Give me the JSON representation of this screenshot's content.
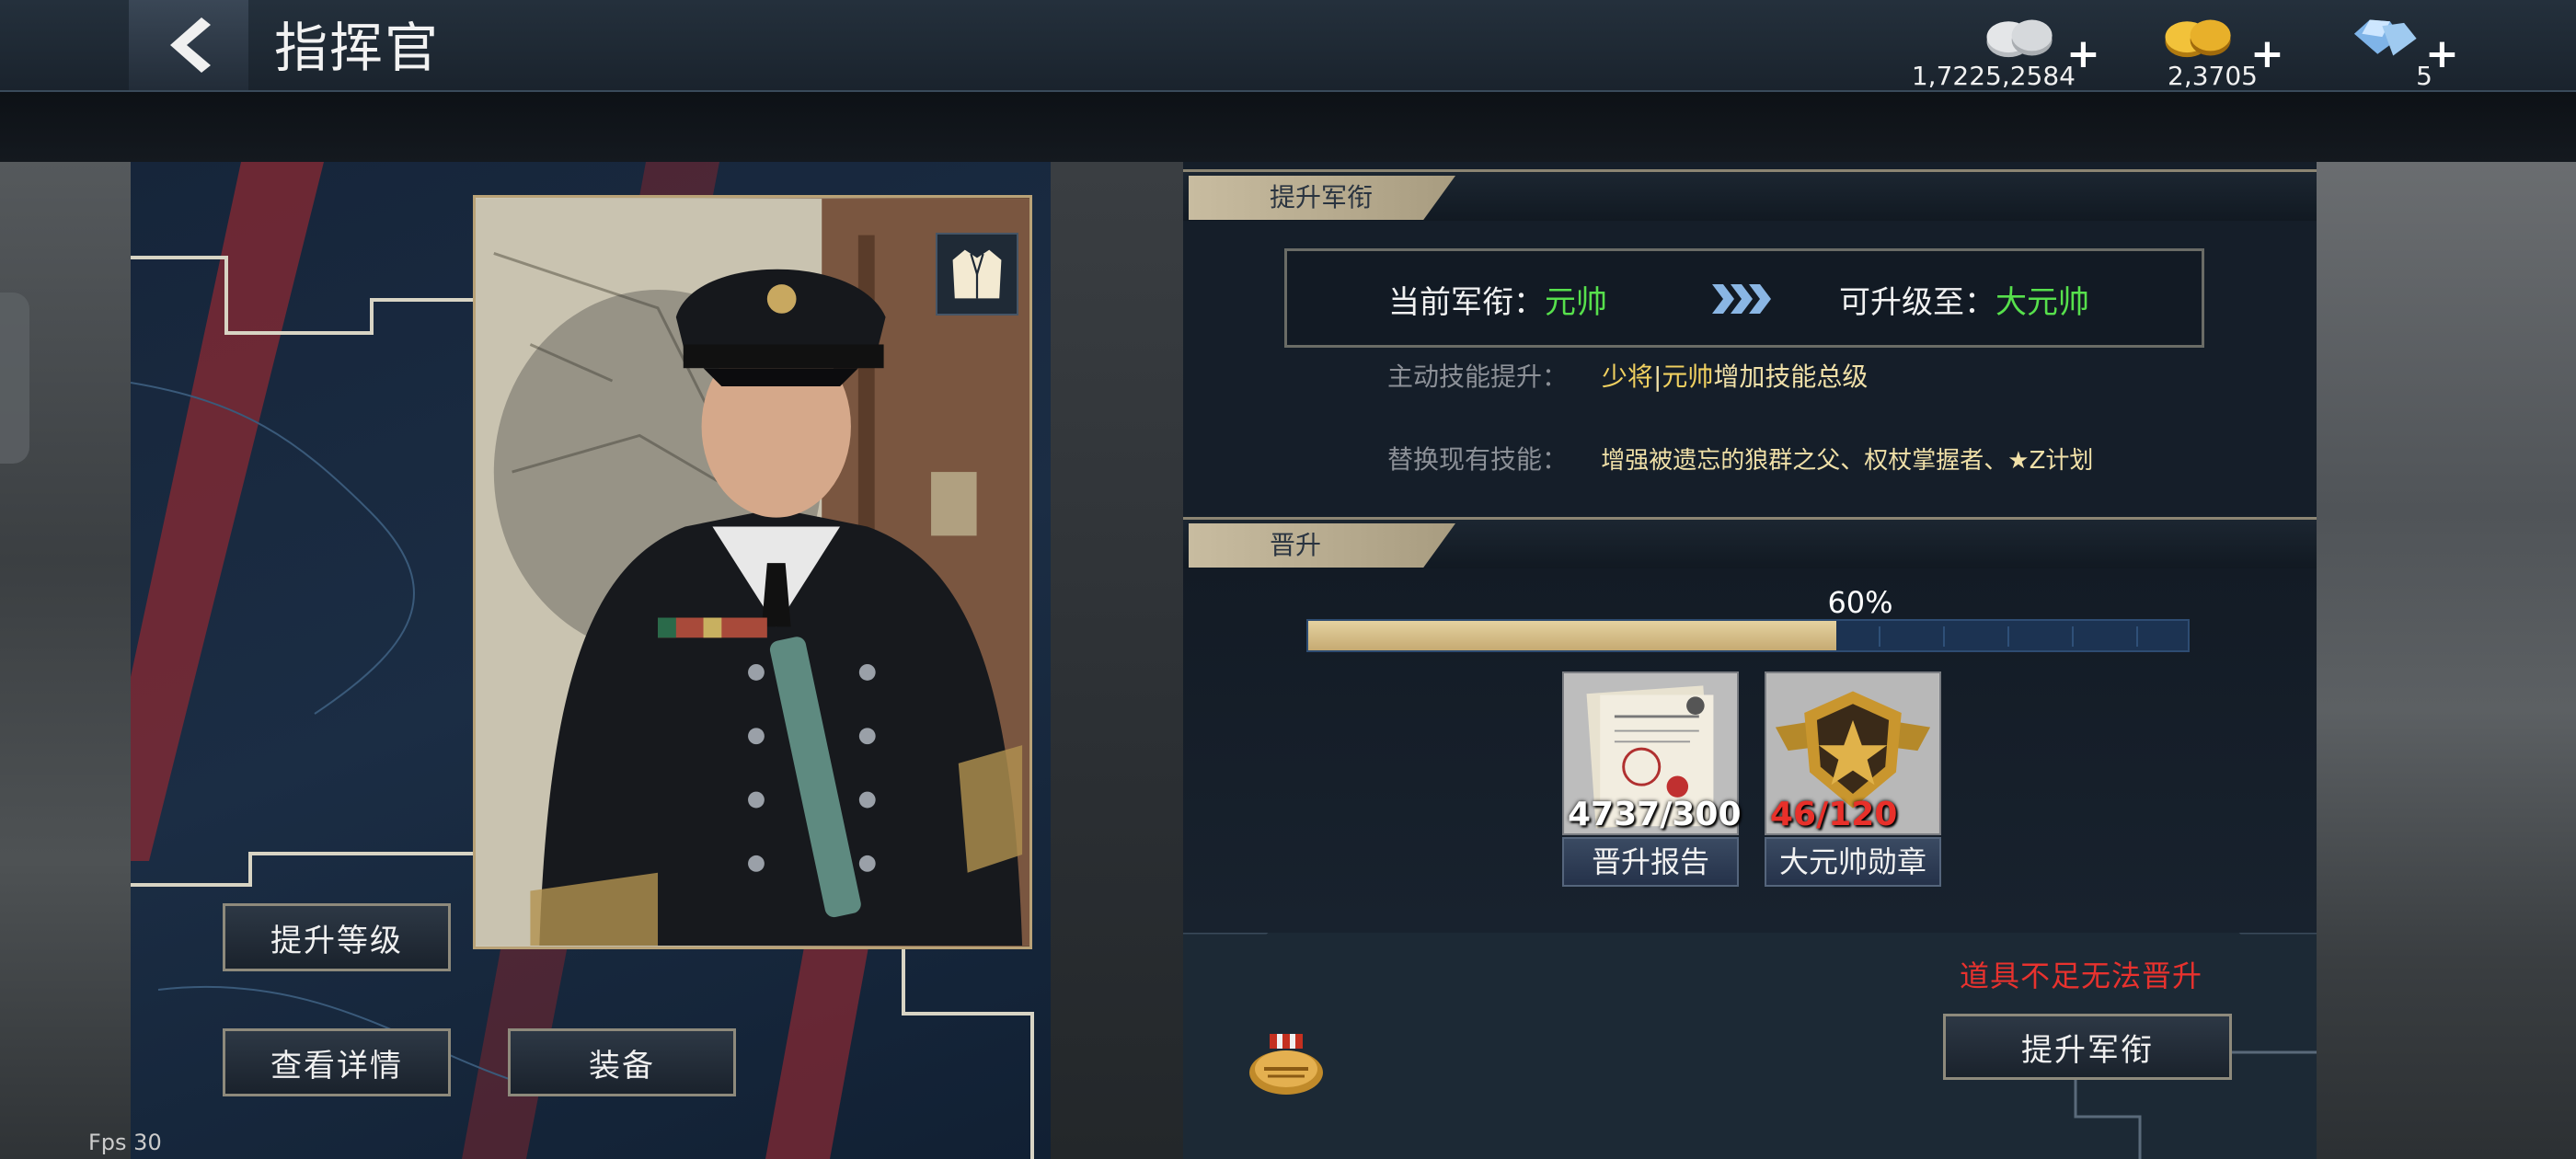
{
  "header": {
    "title": "指挥官",
    "back_icon": "chevron-left-icon"
  },
  "resources": [
    {
      "name": "silver-coins-icon",
      "value": "1,7225,2584",
      "plus": "+"
    },
    {
      "name": "gold-coins-icon",
      "value": "2,3705",
      "plus": "+"
    },
    {
      "name": "diamond-icon",
      "value": "5",
      "plus": "+"
    }
  ],
  "left_panel": {
    "uniform_icon": "uniform-icon",
    "buttons": {
      "upgrade_level": "提升等级",
      "view_details": "查看详情",
      "equipment": "装备"
    }
  },
  "rank_section": {
    "header": "提升军衔",
    "current_label": "当前军衔：",
    "current_rank": "元帅",
    "next_label": "可升级至：",
    "next_rank": "大元帅",
    "skill_boost_key": "主动技能提升：",
    "skill_boost_value_a": "少将",
    "skill_boost_sep": "|",
    "skill_boost_value_b": "元帅",
    "skill_boost_suffix": "增加技能总级",
    "replace_key": "替换现有技能：",
    "replace_value": "增强被遗忘的狼群之父、权杖掌握者、★Z计划"
  },
  "promotion_section": {
    "header": "晋升",
    "progress_text": "60%",
    "progress": 0.6,
    "items": [
      {
        "name": "晋升报告",
        "count": "4737/300",
        "count_color": "#ffffff"
      },
      {
        "name": "大元帅勋章",
        "count": "46/120",
        "count_color": "#e8302a"
      }
    ],
    "warning": "道具不足无法晋升",
    "promote_button": "提升军衔"
  },
  "colors": {
    "accent_gold": "#c6aa72",
    "rank_green": "#57e04c",
    "warning_red": "#e8322e"
  },
  "fps_label": "Fps 30"
}
